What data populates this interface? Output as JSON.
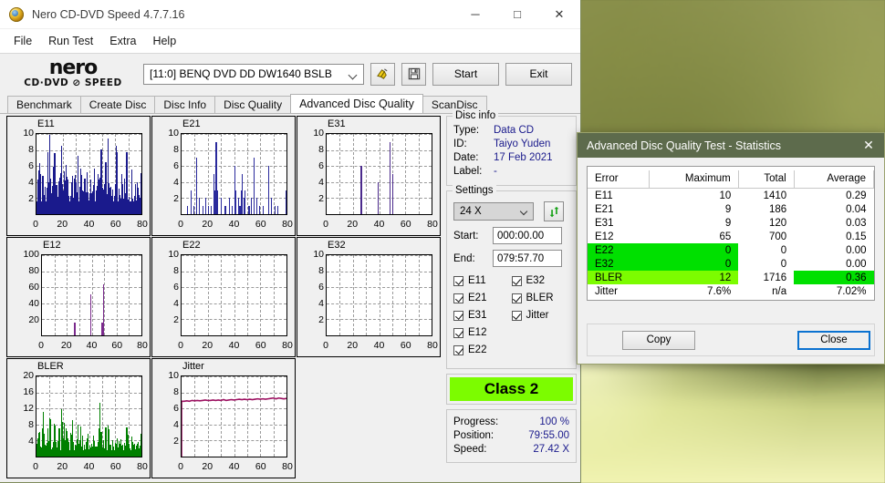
{
  "window": {
    "title": "Nero CD-DVD Speed 4.7.7.16",
    "icon": "nero-disc-icon",
    "controls": {
      "minimize": "─",
      "maximize": "□",
      "close": "✕"
    }
  },
  "menubar": {
    "items": [
      "File",
      "Run Test",
      "Extra",
      "Help"
    ]
  },
  "logo": {
    "line1": "nero",
    "line2": "CD·DVD ⊘ SPEED"
  },
  "toolbar": {
    "drive": "[11:0]   BENQ DVD DD DW1640 BSLB",
    "eject_icon": "eject-disc-icon",
    "save_icon": "floppy-save-icon",
    "start_label": "Start",
    "exit_label": "Exit"
  },
  "tabs": {
    "items": [
      "Benchmark",
      "Create Disc",
      "Disc Info",
      "Disc Quality",
      "Advanced Disc Quality",
      "ScanDisc"
    ],
    "active": "Advanced Disc Quality"
  },
  "disc_info": {
    "legend": "Disc info",
    "rows": [
      {
        "key": "Type:",
        "value": "Data CD"
      },
      {
        "key": "ID:",
        "value": "Taiyo Yuden"
      },
      {
        "key": "Date:",
        "value": "17 Feb 2021"
      },
      {
        "key": "Label:",
        "value": "-"
      }
    ]
  },
  "settings": {
    "legend": "Settings",
    "speed": "24 X",
    "refresh_icon": "refresh-icon",
    "start_label": "Start:",
    "start_value": "000:00.00",
    "end_label": "End:",
    "end_value": "079:57.70",
    "checkboxes": [
      {
        "label": "E11",
        "checked": true
      },
      {
        "label": "E32",
        "checked": true
      },
      {
        "label": "E21",
        "checked": true
      },
      {
        "label": "BLER",
        "checked": true
      },
      {
        "label": "E31",
        "checked": true
      },
      {
        "label": "Jitter",
        "checked": true
      },
      {
        "label": "E12",
        "checked": true
      },
      {
        "label": "",
        "checked": false
      },
      {
        "label": "E22",
        "checked": true
      },
      {
        "label": "",
        "checked": false
      }
    ]
  },
  "class_badge": {
    "text": "Class 2",
    "color": "#7CFC00"
  },
  "progress_panel": {
    "rows": [
      {
        "key": "Progress:",
        "value": "100 %"
      },
      {
        "key": "Position:",
        "value": "79:55.00"
      },
      {
        "key": "Speed:",
        "value": "27.42 X"
      }
    ]
  },
  "stats_dialog": {
    "title": "Advanced Disc Quality Test - Statistics",
    "close_icon": "close-icon",
    "headers": [
      "Error",
      "Maximum",
      "Total",
      "Average"
    ],
    "rows": [
      {
        "error": "E11",
        "maximum": "10",
        "total": "1410",
        "average": "0.29",
        "hl": "none"
      },
      {
        "error": "E21",
        "maximum": "9",
        "total": "186",
        "average": "0.04",
        "hl": "none"
      },
      {
        "error": "E31",
        "maximum": "9",
        "total": "120",
        "average": "0.03",
        "hl": "none"
      },
      {
        "error": "E12",
        "maximum": "65",
        "total": "700",
        "average": "0.15",
        "hl": "none"
      },
      {
        "error": "E22",
        "maximum": "0",
        "total": "0",
        "average": "0.00",
        "hl": "green-left"
      },
      {
        "error": "E32",
        "maximum": "0",
        "total": "0",
        "average": "0.00",
        "hl": "green-left"
      },
      {
        "error": "BLER",
        "maximum": "12",
        "total": "1716",
        "average": "0.36",
        "hl": "chartreuse-left-green-avg"
      },
      {
        "error": "Jitter",
        "maximum": "7.6%",
        "total": "n/a",
        "average": "7.02%",
        "hl": "none"
      }
    ],
    "copy_label": "Copy",
    "close_label": "Close",
    "colors": {
      "titlebar": "#5d6b4c",
      "green": "#00e000",
      "chartreuse": "#7CFC00",
      "focus": "#0b72d0"
    }
  },
  "chart_data": [
    {
      "type": "bar",
      "title": "E11",
      "color": "#1a1a8c",
      "fill": "#1a1a8c",
      "xlabel": "",
      "ylabel": "",
      "xlim": [
        0,
        80
      ],
      "ylim": [
        0,
        10
      ],
      "grid": true,
      "xticks": [
        0,
        20,
        40,
        60,
        80
      ],
      "yticks": [
        2,
        4,
        6,
        8,
        10
      ],
      "dense": true,
      "x": [
        0,
        1,
        2,
        3,
        4,
        5,
        6,
        7,
        8,
        9,
        10,
        11,
        12,
        13,
        14,
        15,
        16,
        17,
        18,
        19,
        20,
        21,
        22,
        23,
        24,
        25,
        26,
        27,
        28,
        29,
        30,
        31,
        32,
        33,
        34,
        35,
        36,
        37,
        38,
        39,
        40,
        41,
        42,
        43,
        44,
        45,
        46,
        47,
        48,
        49,
        50,
        51,
        52,
        53,
        54,
        55,
        56,
        57,
        58,
        59,
        60,
        61,
        62,
        63,
        64,
        65,
        66,
        67,
        68,
        69,
        70,
        71,
        72,
        73,
        74,
        75,
        76,
        77,
        78,
        79,
        80
      ],
      "values": [
        2,
        4,
        9,
        3,
        2,
        8,
        3,
        2,
        6,
        4,
        9,
        3,
        2,
        8,
        5,
        3,
        2,
        7,
        3,
        10,
        3,
        6,
        2,
        7,
        4,
        2,
        3,
        6,
        2,
        5,
        3,
        8,
        2,
        3,
        6,
        2,
        4,
        3,
        2,
        6,
        2,
        4,
        2,
        3,
        7,
        2,
        3,
        5,
        2,
        8,
        3,
        2,
        4,
        6,
        2,
        8,
        3,
        2,
        4,
        2,
        3,
        8,
        2,
        3,
        2,
        5,
        2,
        3,
        2,
        7,
        4,
        2,
        3,
        6,
        2,
        3,
        2,
        4,
        2,
        3,
        5
      ]
    },
    {
      "type": "bar",
      "title": "E21",
      "color": "#2a2a9c",
      "fill": "none",
      "xlim": [
        0,
        80
      ],
      "ylim": [
        0,
        10
      ],
      "grid": true,
      "xticks": [
        0,
        20,
        40,
        60,
        80
      ],
      "yticks": [
        2,
        4,
        6,
        8,
        10
      ],
      "x": [
        4,
        7,
        9,
        11,
        13,
        16,
        18,
        20,
        22,
        24,
        25,
        26,
        27,
        30,
        33,
        36,
        38,
        40,
        41,
        43,
        44,
        45,
        46,
        47,
        48,
        51,
        53,
        55,
        57,
        59,
        62,
        66,
        68,
        71,
        73,
        79,
        80
      ],
      "values": [
        1,
        3,
        1,
        7,
        2,
        1,
        2,
        1,
        1,
        5,
        3,
        9,
        3,
        2,
        1,
        2,
        1,
        6,
        3,
        2,
        1,
        3,
        5,
        2,
        3,
        1,
        2,
        7,
        2,
        1,
        1,
        6,
        2,
        1,
        1,
        3,
        1
      ]
    },
    {
      "type": "bar",
      "title": "E31",
      "color": "#4b2a8c",
      "fill": "none",
      "xlim": [
        0,
        80
      ],
      "ylim": [
        0,
        10
      ],
      "grid": true,
      "xticks": [
        0,
        20,
        40,
        60,
        80
      ],
      "yticks": [
        2,
        4,
        6,
        8,
        10
      ],
      "x": [
        26,
        39,
        48,
        50
      ],
      "values": [
        6,
        4,
        9,
        5
      ]
    },
    {
      "type": "bar",
      "title": "E12",
      "color": "#7a2a8c",
      "fill": "none",
      "xlim": [
        0,
        80
      ],
      "ylim": [
        0,
        100
      ],
      "grid": true,
      "xticks": [
        0,
        20,
        40,
        60,
        80
      ],
      "yticks": [
        20,
        40,
        60,
        80,
        100
      ],
      "x": [
        26,
        39,
        48,
        49
      ],
      "values": [
        16,
        51,
        16,
        64
      ]
    },
    {
      "type": "bar",
      "title": "E22",
      "color": "#2a2a9c",
      "fill": "none",
      "xlim": [
        0,
        80
      ],
      "ylim": [
        0,
        10
      ],
      "grid": true,
      "xticks": [
        0,
        20,
        40,
        60,
        80
      ],
      "yticks": [
        2,
        4,
        6,
        8,
        10
      ],
      "x": [],
      "values": []
    },
    {
      "type": "bar",
      "title": "E32",
      "color": "#2a2a9c",
      "fill": "none",
      "xlim": [
        0,
        80
      ],
      "ylim": [
        0,
        10
      ],
      "grid": true,
      "xticks": [
        0,
        20,
        40,
        60,
        80
      ],
      "yticks": [
        2,
        4,
        6,
        8,
        10
      ],
      "x": [],
      "values": []
    },
    {
      "type": "bar",
      "title": "BLER",
      "color": "#008000",
      "fill": "#008000",
      "xlim": [
        0,
        80
      ],
      "ylim": [
        0,
        20
      ],
      "grid": true,
      "xticks": [
        0,
        20,
        40,
        60,
        80
      ],
      "yticks": [
        4,
        8,
        12,
        16,
        20
      ],
      "dense": true,
      "x": [
        0,
        1,
        2,
        3,
        4,
        5,
        6,
        7,
        8,
        9,
        10,
        11,
        12,
        13,
        14,
        15,
        16,
        17,
        18,
        19,
        20,
        21,
        22,
        23,
        24,
        25,
        26,
        27,
        28,
        29,
        30,
        31,
        32,
        33,
        34,
        35,
        36,
        37,
        38,
        39,
        40,
        41,
        42,
        43,
        44,
        45,
        46,
        47,
        48,
        49,
        50,
        51,
        52,
        53,
        54,
        55,
        56,
        57,
        58,
        59,
        60,
        61,
        62,
        63,
        64,
        65,
        66,
        67,
        68,
        69,
        70,
        71,
        72,
        73,
        74,
        75,
        76,
        77,
        78,
        79,
        80
      ],
      "values": [
        2,
        5,
        9,
        3,
        2,
        8,
        4,
        2,
        6,
        5,
        12,
        3,
        2,
        9,
        6,
        4,
        2,
        8,
        3,
        11,
        4,
        6,
        2,
        9,
        4,
        2,
        3,
        7,
        2,
        5,
        3,
        8,
        2,
        3,
        6,
        2,
        4,
        3,
        2,
        7,
        2,
        4,
        2,
        3,
        8,
        2,
        3,
        5,
        12,
        8,
        3,
        2,
        4,
        6,
        2,
        8,
        3,
        2,
        4,
        2,
        3,
        6,
        2,
        3,
        2,
        5,
        2,
        3,
        2,
        8,
        4,
        2,
        3,
        6,
        2,
        3,
        2,
        4,
        2,
        3,
        7
      ]
    },
    {
      "type": "line",
      "title": "Jitter",
      "color": "#9c1060",
      "fill": "none",
      "xlim": [
        0,
        80
      ],
      "ylim": [
        0,
        10
      ],
      "grid": true,
      "xticks": [
        0,
        20,
        40,
        60,
        80
      ],
      "yticks": [
        2,
        4,
        6,
        8,
        10
      ],
      "x": [
        0,
        2,
        4,
        6,
        8,
        10,
        12,
        14,
        16,
        18,
        20,
        22,
        24,
        26,
        28,
        30,
        32,
        34,
        36,
        38,
        40,
        42,
        44,
        46,
        48,
        50,
        52,
        54,
        56,
        58,
        60,
        62,
        64,
        66,
        68,
        70,
        72,
        74,
        76,
        78,
        80
      ],
      "values": [
        6.9,
        6.9,
        6.95,
        6.9,
        7.0,
        6.95,
        7.0,
        6.95,
        7.0,
        7.05,
        7.0,
        7.0,
        7.05,
        7.0,
        7.05,
        7.0,
        7.1,
        7.0,
        7.05,
        7.1,
        7.05,
        7.1,
        7.15,
        7.1,
        7.15,
        7.1,
        7.15,
        7.1,
        7.15,
        7.2,
        7.15,
        7.2,
        7.15,
        7.2,
        7.25,
        7.3,
        7.2,
        7.3,
        7.25,
        7.2,
        7.25
      ]
    }
  ]
}
